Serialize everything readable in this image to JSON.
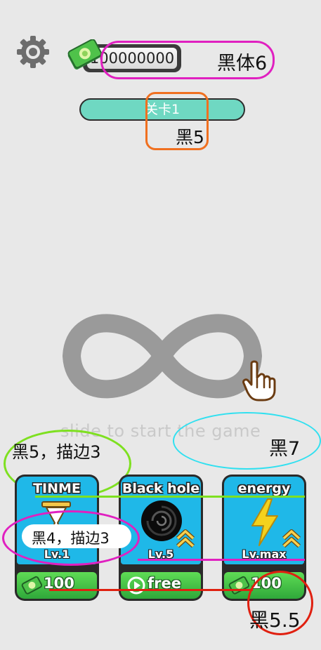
{
  "header": {
    "money_value": "100000000",
    "level_label": "关卡1"
  },
  "center": {
    "hint_text": "slide to start the game"
  },
  "cards": [
    {
      "title": "TINME",
      "level": "Lv.1",
      "button_label": "100",
      "button_icon": "money-icon"
    },
    {
      "title": "Black hole",
      "level": "Lv.5",
      "button_label": "free",
      "button_icon": "play-icon"
    },
    {
      "title": "energy",
      "level": "Lv.max",
      "button_label": "100",
      "button_icon": "money-icon"
    }
  ],
  "annotations": {
    "money_font": "黑体6",
    "level_font": "黑5",
    "card_title_font": "黑5，描边3",
    "hint_font": "黑7",
    "card_level_font": "黑4，描边3",
    "button_font": "黑5.5"
  },
  "colors": {
    "background": "#e8e8e8",
    "level_bar": "#6fd8c2",
    "card_panel": "#1fb8e8",
    "button_green": "#3fbf45",
    "annotation_magenta": "#e020c0",
    "annotation_orange": "#f07020",
    "annotation_green": "#7ee020",
    "annotation_cyan": "#30e0f0",
    "annotation_red": "#e02010"
  }
}
